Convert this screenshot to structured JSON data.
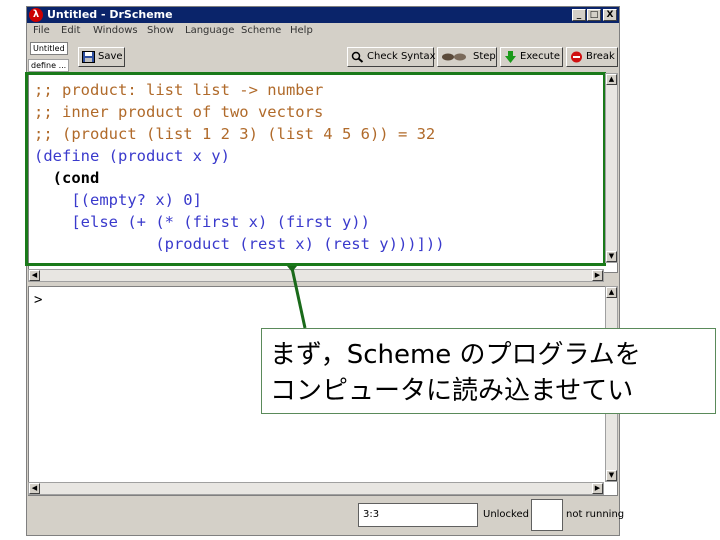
{
  "window": {
    "title": "Untitled - DrScheme",
    "app_icon": "λ",
    "controls": {
      "minimize": "_",
      "maximize": "□",
      "close": "X"
    }
  },
  "menu": [
    "File",
    "Edit",
    "Windows",
    "Show",
    "Language",
    "Scheme",
    "Help"
  ],
  "toolbar": {
    "file_button": "Untitled",
    "define_button": "define ...",
    "save": "Save",
    "check_syntax": "Check Syntax",
    "step": "Step",
    "execute": "Execute",
    "break": "Break"
  },
  "editor": {
    "lines": [
      ";; product: list list -> number",
      ";; inner product of two vectors",
      ";; (product (list 1 2 3) (list 4 5 6)) = 32",
      "(define (product x y)",
      "  (cond",
      "    [(empty? x) 0]",
      "    [else (+ (* (first x) (first y))",
      "             (product (rest x) (rest y)))]))"
    ]
  },
  "interactions": {
    "prompt": ">"
  },
  "status": {
    "position": "3:3",
    "lock": "Unlocked",
    "running": "not running"
  },
  "annotation": {
    "line1": "まず，Scheme のプログラムを",
    "line2": "コンピュータに読み込ませてい"
  },
  "colors": {
    "highlight_border": "#1a7a1a",
    "comment": "#b06a2a",
    "identifier": "#3a3acc",
    "title_bar": "#0a246a"
  }
}
